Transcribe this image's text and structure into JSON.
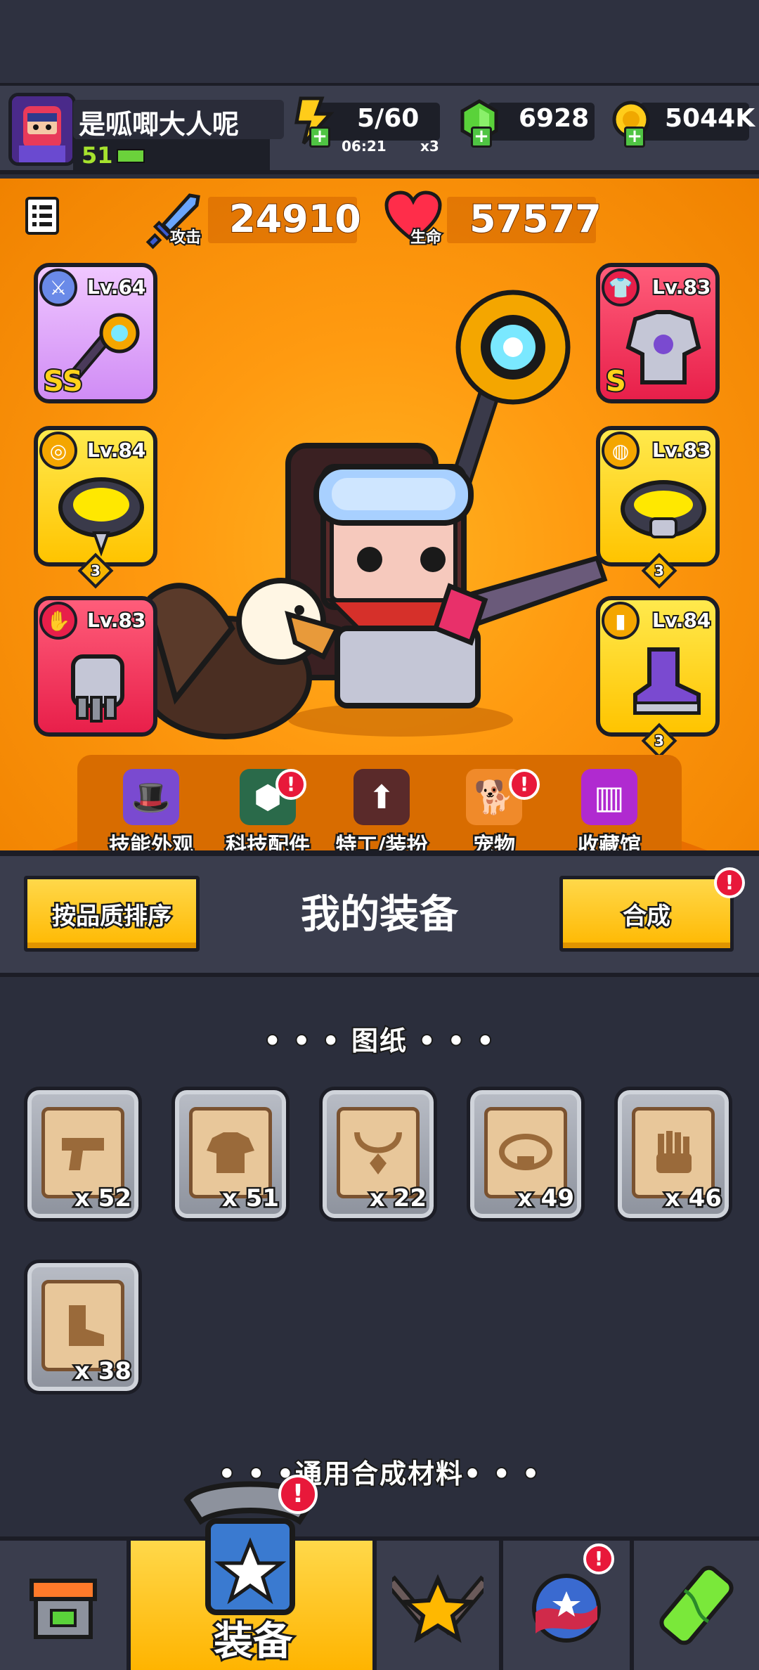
{
  "player": {
    "name": "是呱唧大人呢",
    "level": "51"
  },
  "resources": {
    "energy": "5/60",
    "energy_timer": "06:21",
    "energy_mult": "x3",
    "gems": "6928",
    "coins": "5044K"
  },
  "stats": {
    "attack_value": "24910",
    "attack_label": "攻击",
    "hp_value": "57577",
    "hp_label": "生命"
  },
  "gear_slots": [
    {
      "level": "Lv.64",
      "grade": "SS",
      "stars": ""
    },
    {
      "level": "Lv.84",
      "grade": "",
      "stars": "3"
    },
    {
      "level": "Lv.83",
      "grade": "",
      "stars": ""
    },
    {
      "level": "Lv.83",
      "grade": "S",
      "stars": ""
    },
    {
      "level": "Lv.83",
      "grade": "",
      "stars": "3"
    },
    {
      "level": "Lv.84",
      "grade": "",
      "stars": "3"
    }
  ],
  "features": [
    {
      "label": "技能外观"
    },
    {
      "label": "科技配件"
    },
    {
      "label": "特工/装扮"
    },
    {
      "label": "宠物"
    },
    {
      "label": "收藏馆"
    }
  ],
  "equipment": {
    "sort_button": "按品质排序",
    "title": "我的装备",
    "merge_button": "合成"
  },
  "blueprints": {
    "title": "• • •  图纸  • • •",
    "items": [
      {
        "icon": "gun-icon",
        "count": "x 52"
      },
      {
        "icon": "shirt-icon",
        "count": "x 51"
      },
      {
        "icon": "necklace-icon",
        "count": "x 22"
      },
      {
        "icon": "belt-icon",
        "count": "x 49"
      },
      {
        "icon": "glove-icon",
        "count": "x 46"
      },
      {
        "icon": "boot-icon",
        "count": "x 38"
      }
    ]
  },
  "materials": {
    "title": "• • •通用合成材料• • •"
  },
  "nav": {
    "equip_label": "装备",
    "alert": "!"
  }
}
